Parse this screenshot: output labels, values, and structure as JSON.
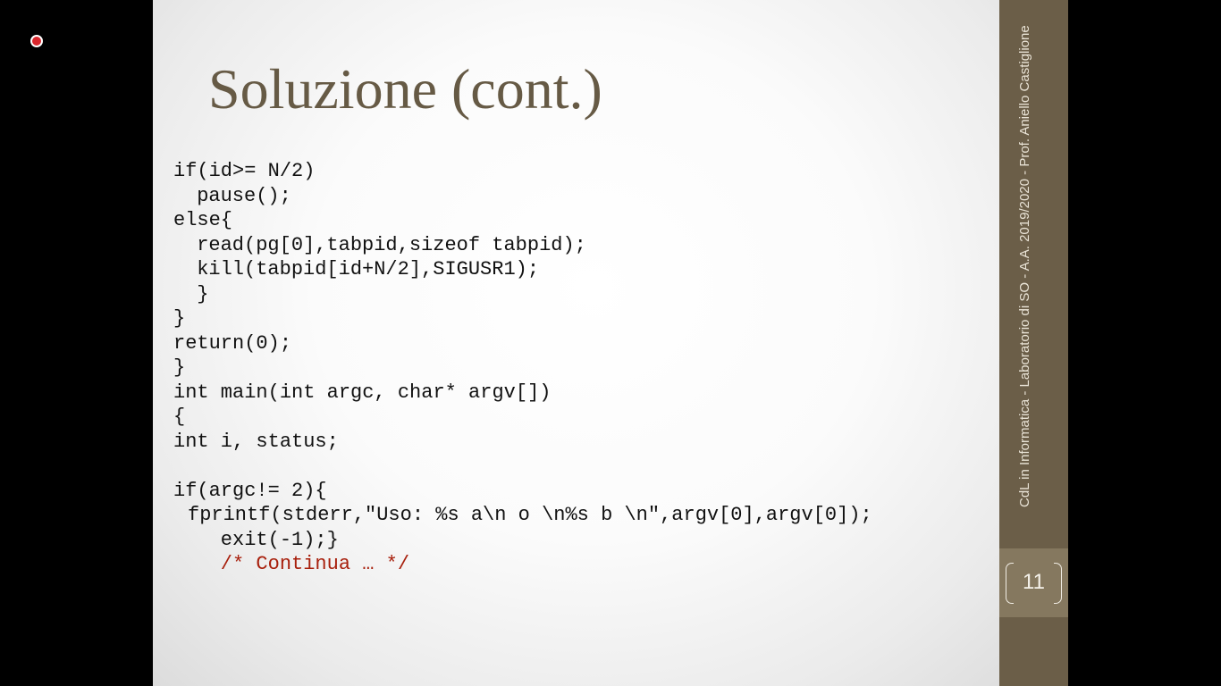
{
  "slide": {
    "title": "Soluzione (cont.)",
    "code_lines": [
      "if(id>= N/2)",
      " pause();",
      "else{",
      " read(pg[0],tabpid,sizeof tabpid);",
      " kill(tabpid[id+N/2],SIGUSR1);",
      " }",
      "}",
      "return(0);",
      "}",
      "int main(int argc, char* argv[])",
      "{",
      "int i, status;",
      "",
      "if(argc!= 2){",
      "fprintf(stderr,\"Uso: %s a\\n o \\n%s b \\n\",argv[0],argv[0]);",
      "    exit(-1);}",
      "    /* Continua … */"
    ],
    "footer": "CdL in Informatica - Laboratorio di SO - A.A. 2019/2020 - Prof. Aniello Castiglione",
    "page_number": "11"
  },
  "colors": {
    "title": "#665a45",
    "sidebar": "#6b5e48",
    "page_box": "#85785f",
    "comment": "#a8200d",
    "recording_dot": "#d9262c"
  },
  "icons": {
    "recording_indicator": "recording-indicator-icon"
  }
}
